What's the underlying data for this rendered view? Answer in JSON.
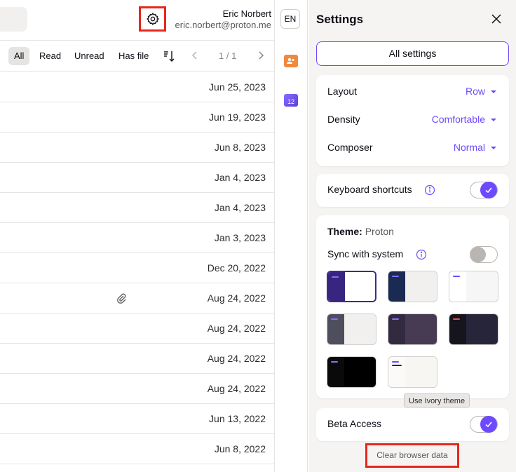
{
  "header": {
    "user_name": "Eric Norbert",
    "user_email": "eric.norbert@proton.me",
    "settings_icon": "gear-icon"
  },
  "filters": {
    "all": "All",
    "read": "Read",
    "unread": "Unread",
    "has_file": "Has file",
    "pager": "1 / 1"
  },
  "mail_dates": [
    "Jun 25, 2023",
    "Jun 19, 2023",
    "Jun 8, 2023",
    "Jan 4, 2023",
    "Jan 4, 2023",
    "Jan 3, 2023",
    "Dec 20, 2022",
    "Aug 24, 2022",
    "Aug 24, 2022",
    "Aug 24, 2022",
    "Aug 24, 2022",
    "Jun 13, 2022",
    "Jun 8, 2022"
  ],
  "rail": {
    "language": "EN",
    "calendar_day": "12"
  },
  "settings": {
    "title": "Settings",
    "all_settings": "All settings",
    "layout_label": "Layout",
    "layout_value": "Row",
    "density_label": "Density",
    "density_value": "Comfortable",
    "composer_label": "Composer",
    "composer_value": "Normal",
    "keyboard_label": "Keyboard shortcuts",
    "keyboard_on": true,
    "theme_label": "Theme:",
    "theme_value": "Proton",
    "sync_label": "Sync with system",
    "sync_on": false,
    "tooltip": "Use Ivory theme",
    "beta_label": "Beta Access",
    "beta_on": true,
    "clear_data": "Clear browser data"
  },
  "colors": {
    "accent": "#6d4aff",
    "highlight_box": "#e8261b"
  }
}
